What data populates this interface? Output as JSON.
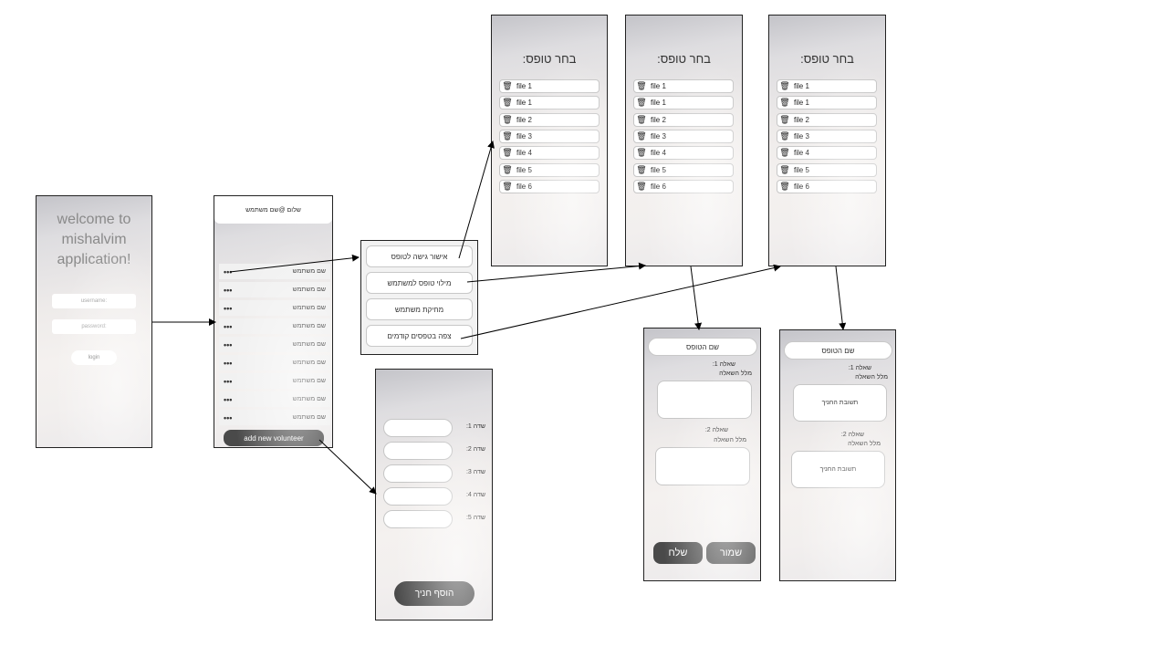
{
  "login": {
    "welcome_line1": "welcome to",
    "welcome_line2": "mishalvim",
    "welcome_line3": "application!",
    "username_placeholder": "username:",
    "password_placeholder": "password:",
    "login_label": "login"
  },
  "volunteers": {
    "greeting": "שלום @שם משתמש",
    "rows": [
      {
        "dots": "•••",
        "name": "שם משתמש"
      },
      {
        "dots": "•••",
        "name": "שם משתמש"
      },
      {
        "dots": "•••",
        "name": "שם משתמש"
      },
      {
        "dots": "•••",
        "name": "שם משתמש"
      },
      {
        "dots": "•••",
        "name": "שם משתמש"
      },
      {
        "dots": "•••",
        "name": "שם משתמש"
      },
      {
        "dots": "•••",
        "name": "שם משתמש"
      },
      {
        "dots": "•••",
        "name": "שם משתמש"
      },
      {
        "dots": "•••",
        "name": "שם משתמש"
      }
    ],
    "add_button": "add new volunteer"
  },
  "menu": {
    "items": [
      "אישור גישה לטופס",
      "מילוי טופס למשתמש",
      "מחיקת משתמש",
      "צפה בטפסים קודמים"
    ]
  },
  "add_student": {
    "fields": [
      "שדה 1:",
      "שדה 2:",
      "שדה 3:",
      "שדה 4:",
      "שדה 5:"
    ],
    "add_button": "הוסף חניך"
  },
  "file_screens": [
    {
      "title": "בחר טופס:",
      "files": [
        "file 1",
        "file 1",
        "file 2",
        "file 3",
        "file 4",
        "file 5",
        "file 6"
      ]
    },
    {
      "title": "בחר טופס:",
      "files": [
        "file 1",
        "file 1",
        "file 2",
        "file 3",
        "file 4",
        "file 5",
        "file 6"
      ]
    },
    {
      "title": "בחר טופס:",
      "files": [
        "file 1",
        "file 1",
        "file 2",
        "file 3",
        "file 4",
        "file 5",
        "file 6"
      ]
    }
  ],
  "form_edit": {
    "form_name": "שם הטופס",
    "q1_title": "שאלה 1:",
    "q1_body": "מלל השאלה",
    "q2_title": "שאלה 2:",
    "q2_body": "מלל השאלה",
    "send_label": "שלח",
    "save_label": "שמור"
  },
  "form_view": {
    "form_name": "שם הטופס",
    "q1_title": "שאלה 1:",
    "q1_body": "מלל השאלה",
    "a1": "תשובת החניך",
    "q2_title": "שאלה 2:",
    "q2_body": "מלל השאלה",
    "a2": "תשובת החניך"
  },
  "icons": {
    "trash": "trash-icon",
    "dots": "more-dots-icon"
  },
  "colors": {
    "dark_button": "#4a4a4a",
    "frame": "#222222",
    "arrow": "#000000"
  }
}
